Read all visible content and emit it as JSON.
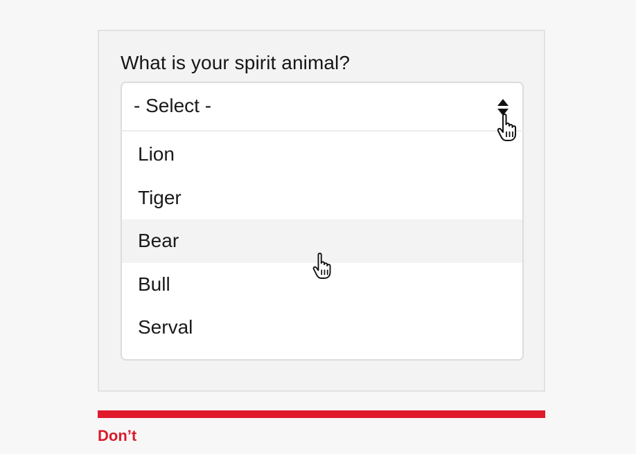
{
  "form": {
    "question": "What is your spirit animal?",
    "select": {
      "value": "- Select -",
      "icon": "sort-arrows-icon",
      "expanded": true
    },
    "options": [
      {
        "label": "Lion"
      },
      {
        "label": "Tiger"
      },
      {
        "label": "Bear",
        "hovered": true
      },
      {
        "label": "Bull"
      },
      {
        "label": "Serval"
      }
    ]
  },
  "verdict": {
    "label": "Don’t",
    "color": "#e01a2b"
  },
  "colors": {
    "page_background": "#f7f7f7",
    "card_background": "#f3f3f3",
    "hover_background": "#f3f3f3",
    "border": "#dcdcdc"
  }
}
